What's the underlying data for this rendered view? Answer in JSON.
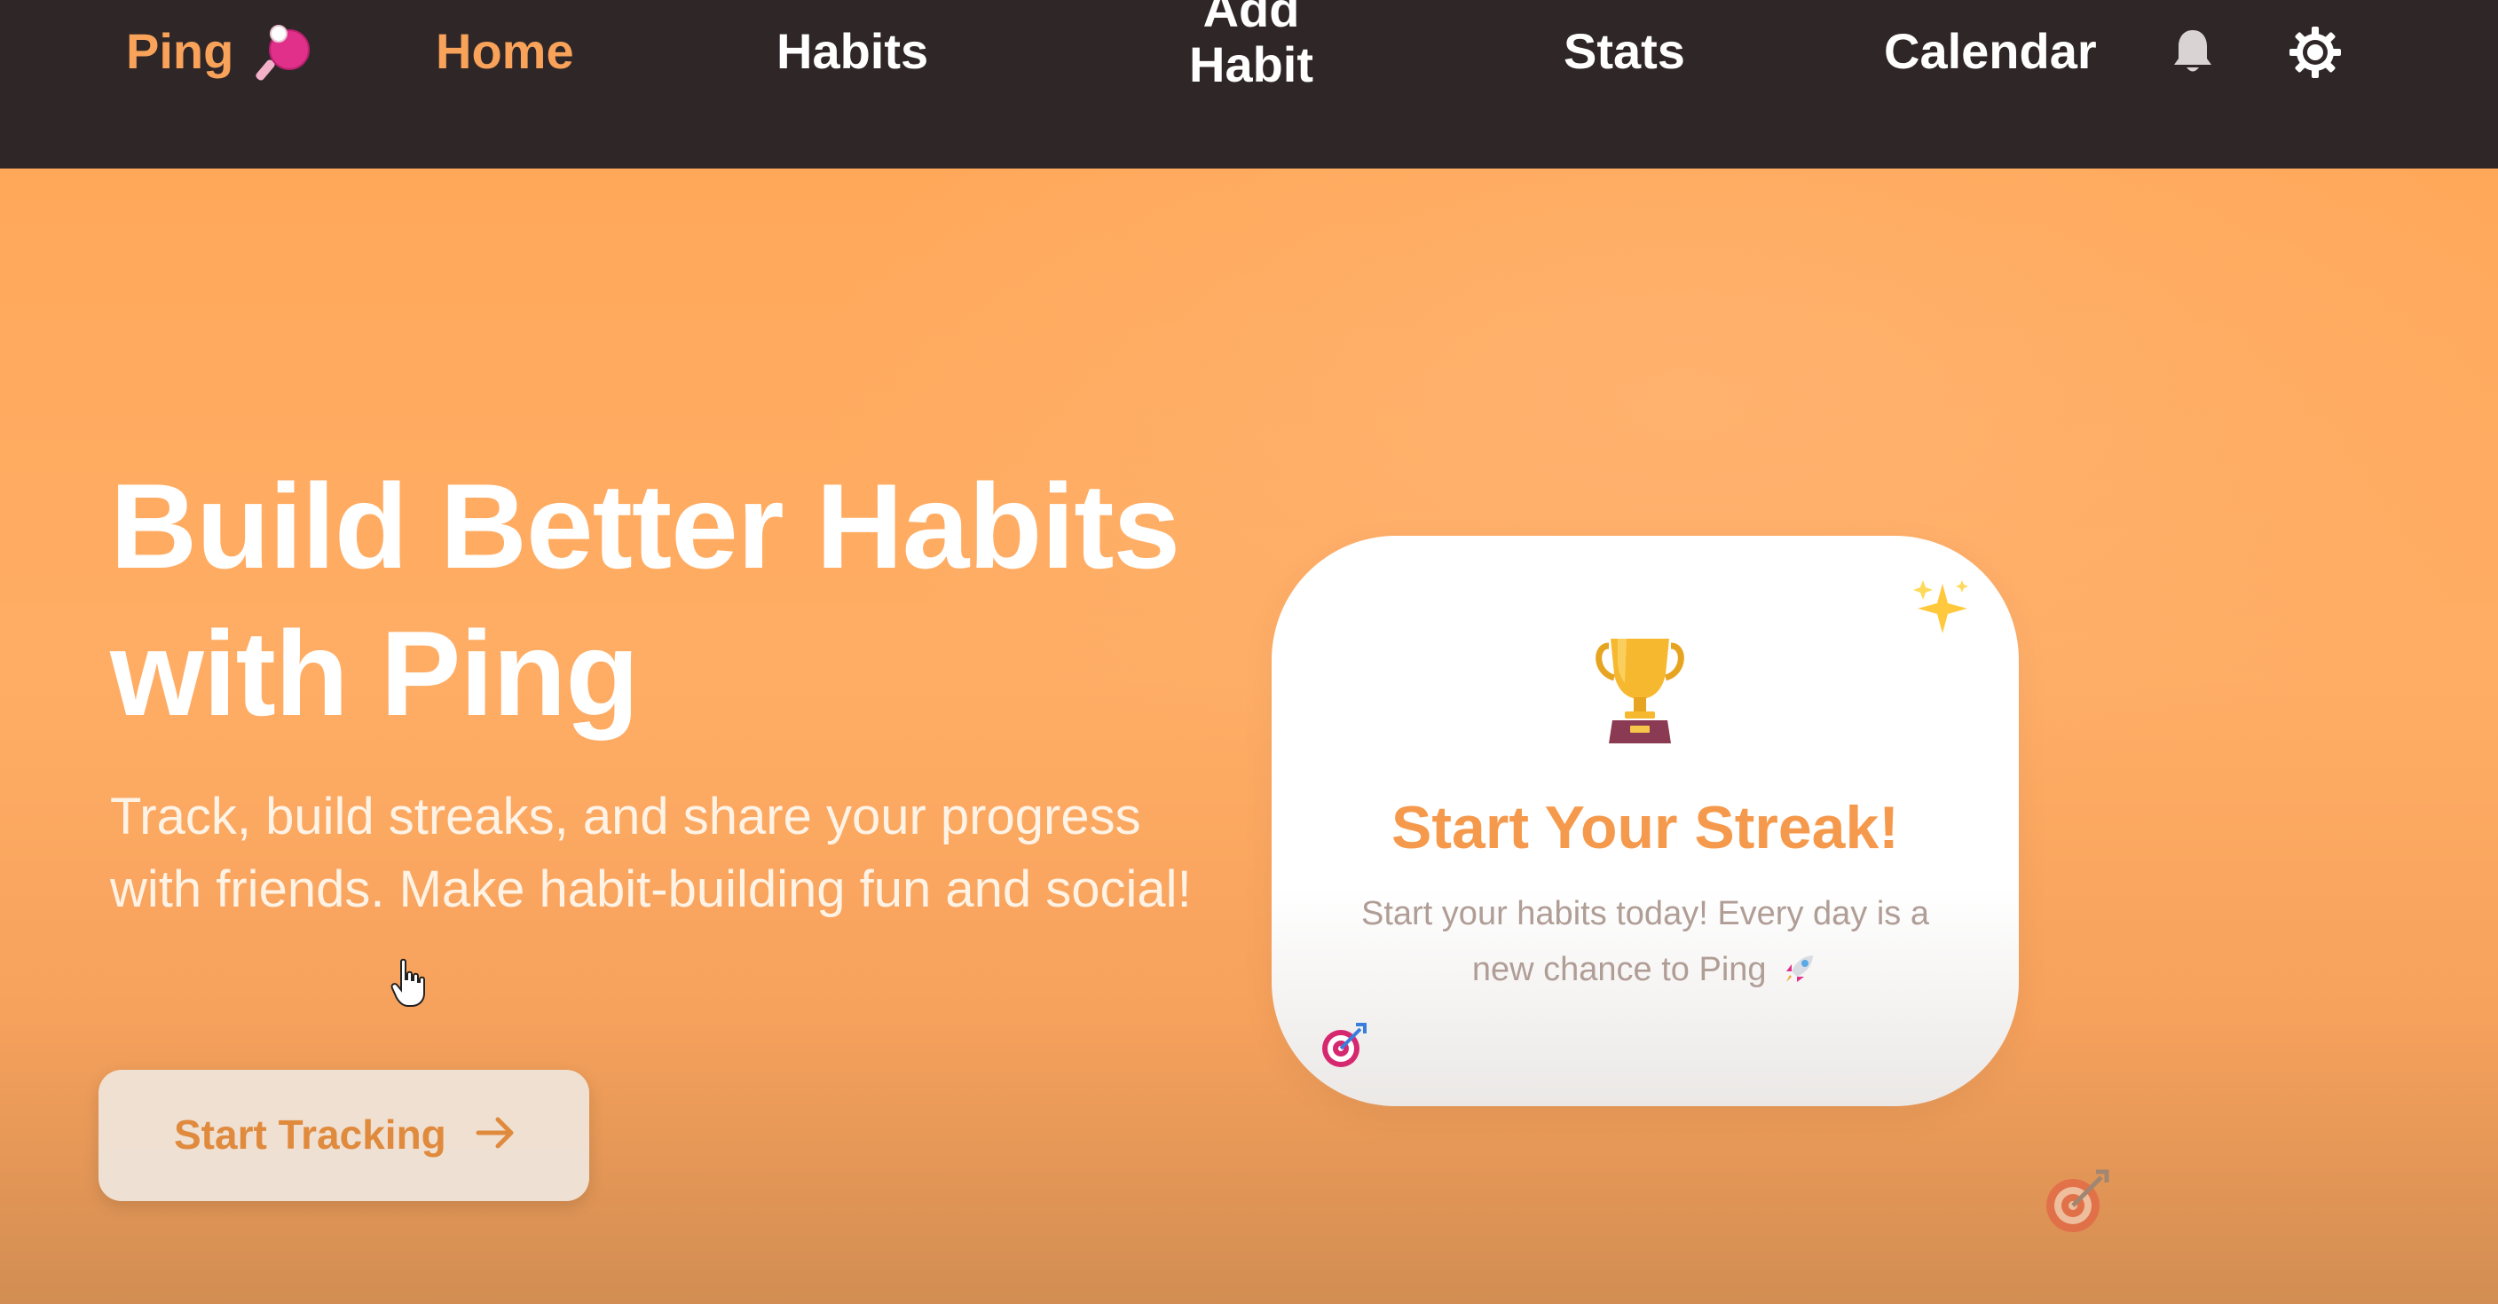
{
  "nav": {
    "brand": "Ping",
    "brand_icon": "ping-pong-paddle-icon",
    "items": {
      "home": "Home",
      "habits": "Habits",
      "add_habit_line1": "Add",
      "add_habit_line2": "Habit",
      "stats": "Stats",
      "calendar": "Calendar"
    },
    "active_item": "Home",
    "icons": [
      "bell-icon",
      "gear-icon"
    ]
  },
  "hero": {
    "headline_line1": "Build Better Habits",
    "headline_line2": "with Ping",
    "subtext": "Track, build streaks, and share your progress with friends. Make habit-building fun and social!",
    "cta_label": "Start Tracking",
    "cta_icon": "arrow-right-icon"
  },
  "card": {
    "title": "Start Your Streak!",
    "text": "Start your habits today! Every day is a new chance to Ping",
    "icons": [
      "sparkles-icon",
      "trophy-icon",
      "rocket-icon",
      "target-icon"
    ]
  },
  "colors": {
    "nav_bg": "#2f2627",
    "accent": "#f9a259",
    "hero_orange": "#ffad65",
    "card_title": "#f59a4d"
  }
}
